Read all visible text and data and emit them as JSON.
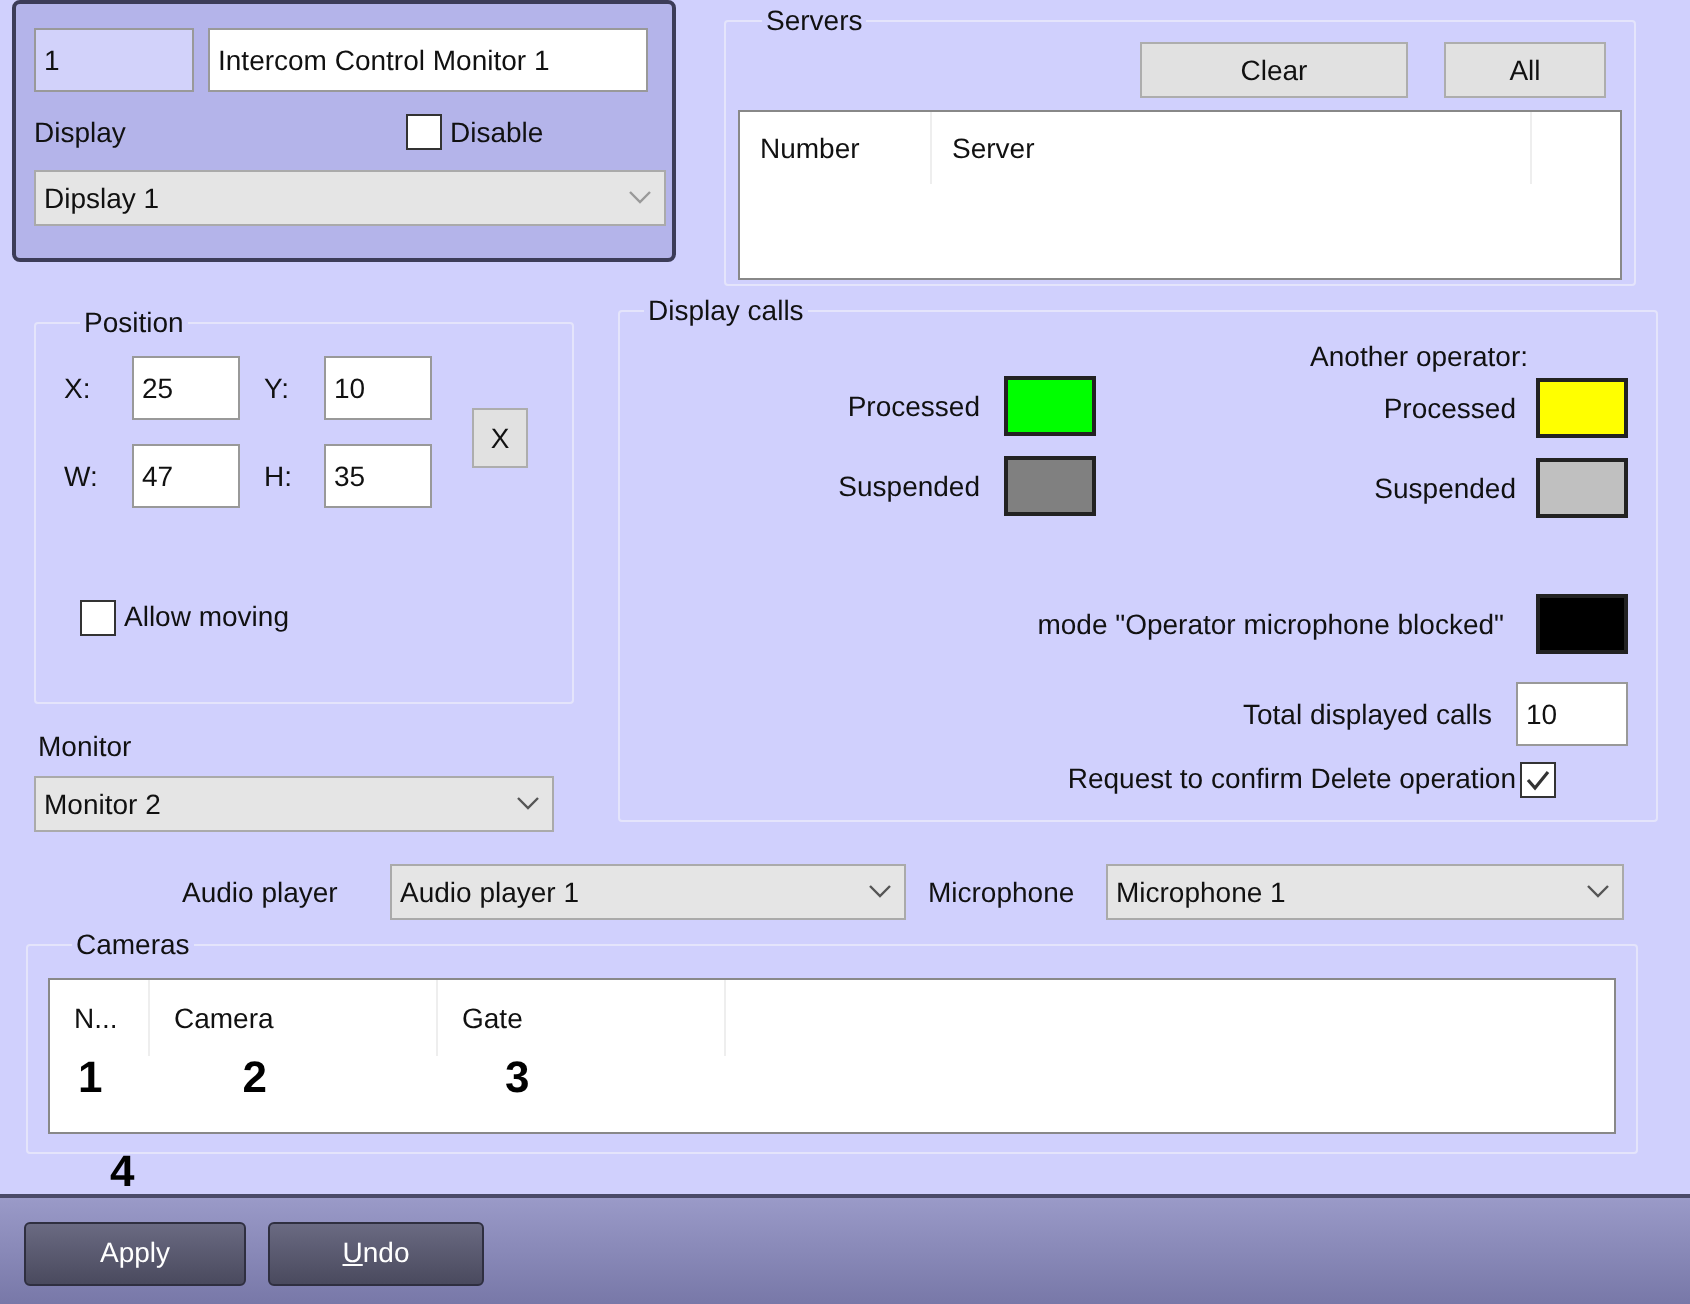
{
  "monitor_panel": {
    "id": "1",
    "name": "Intercom Control Monitor 1",
    "display_label": "Display",
    "disable": {
      "label": "Disable",
      "checked": false
    },
    "display_select": "Dipslay 1"
  },
  "servers": {
    "title": "Servers",
    "buttons": [
      "Clear",
      "All"
    ],
    "columns": [
      "Number",
      "Server"
    ]
  },
  "position": {
    "title": "Position",
    "fields": [
      {
        "label": "X:",
        "value": "25"
      },
      {
        "label": "Y:",
        "value": "10"
      },
      {
        "label": "W:",
        "value": "47"
      },
      {
        "label": "H:",
        "value": "35"
      }
    ],
    "reset_button": "X",
    "allow_moving": {
      "label": "Allow moving",
      "checked": false
    }
  },
  "monitor": {
    "label": "Monitor",
    "value": "Monitor 2"
  },
  "display_calls": {
    "title": "Display calls",
    "another_operator_label": "Another operator:",
    "own": [
      {
        "label": "Processed",
        "color": "#00ff00"
      },
      {
        "label": "Suspended",
        "color": "#808080"
      }
    ],
    "another": [
      {
        "label": "Processed",
        "color": "#ffff00"
      },
      {
        "label": "Suspended",
        "color": "#c0c0c0"
      }
    ],
    "blocked": {
      "label": "mode \"Operator microphone blocked\"",
      "color": "#000000"
    },
    "total": {
      "label": "Total displayed calls",
      "value": "10"
    },
    "confirm_delete": {
      "label": "Request to confirm Delete operation",
      "checked": true
    }
  },
  "audio": {
    "label": "Audio player",
    "value": "Audio player 1"
  },
  "microphone": {
    "label": "Microphone",
    "value": "Microphone 1"
  },
  "cameras": {
    "title": "Cameras",
    "columns": [
      "N...",
      "Camera",
      "Gate"
    ]
  },
  "annotations": [
    "1",
    "2",
    "3",
    "4"
  ],
  "footer_buttons": [
    {
      "label": "Apply",
      "mnemonic": false
    },
    {
      "label": "Undo",
      "mnemonic": true
    }
  ]
}
